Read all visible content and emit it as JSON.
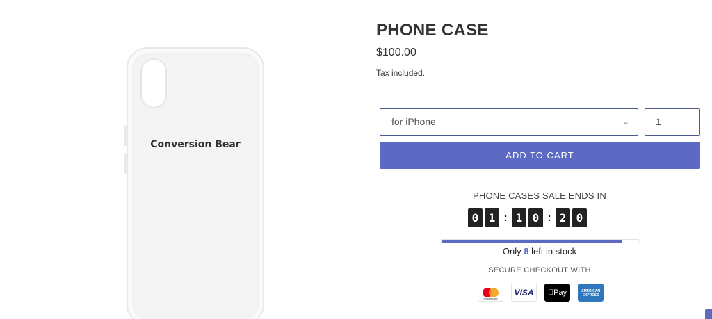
{
  "product": {
    "title": "PHONE CASE",
    "price": "$100.00",
    "tax_note": "Tax included.",
    "image_brand_text": "Conversion Bear"
  },
  "variant": {
    "selected": "for iPhone",
    "chevron_icon": "chevron-down-icon"
  },
  "quantity": {
    "value": "1"
  },
  "cart": {
    "add_label": "ADD TO CART"
  },
  "timer": {
    "title": "PHONE CASES SALE ENDS IN",
    "hours": [
      "0",
      "1"
    ],
    "minutes": [
      "1",
      "0"
    ],
    "seconds": [
      "2",
      "0"
    ],
    "separator": ":"
  },
  "stock": {
    "prefix": "Only",
    "count": "8",
    "suffix": "left in stock",
    "level_fraction": 0.92
  },
  "secure_checkout": {
    "label": "SECURE CHECKOUT WITH",
    "methods": [
      {
        "name": "mastercard-icon",
        "label": "mastercard"
      },
      {
        "name": "visa-icon",
        "label": "VISA"
      },
      {
        "name": "apple-pay-icon",
        "label": "Pay"
      },
      {
        "name": "amex-icon",
        "label": "AMERICAN EXPRESS"
      }
    ]
  },
  "colors": {
    "accent": "#5c6ac4",
    "digit_bg": "#222222",
    "select_border": "#4f5a8c"
  }
}
